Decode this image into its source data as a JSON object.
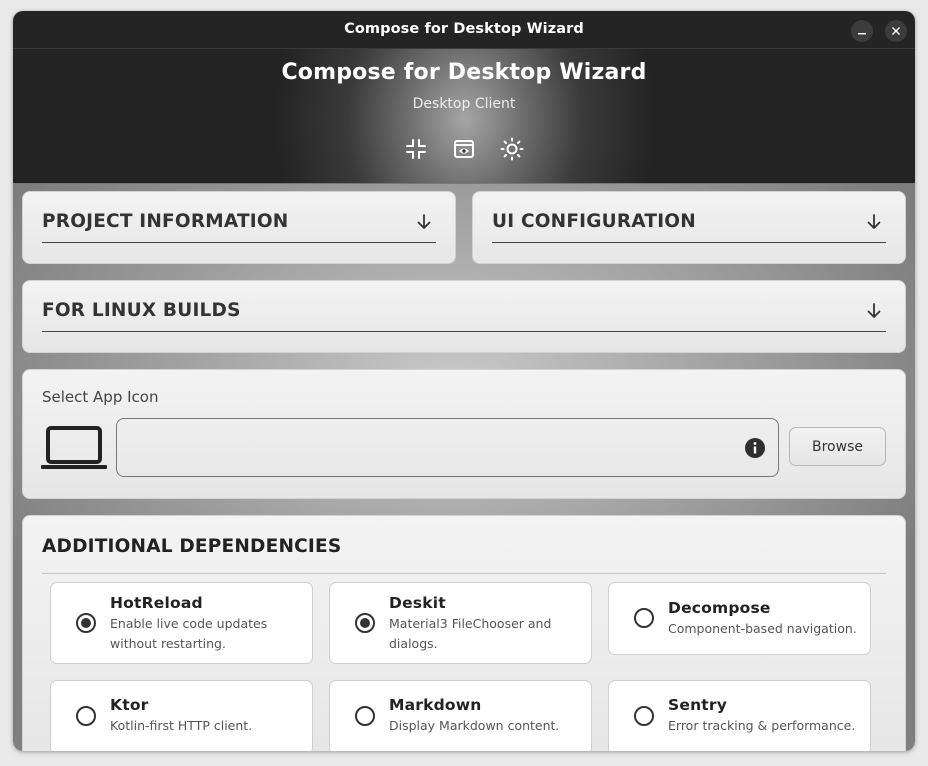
{
  "window": {
    "title": "Compose for Desktop Wizard",
    "minimize_icon": "minimize-icon",
    "close_icon": "close-icon"
  },
  "header": {
    "title": "Compose for Desktop Wizard",
    "subtitle": "Desktop Client",
    "actions": [
      "collapse-icon",
      "preview-icon",
      "theme-icon"
    ]
  },
  "sections": {
    "project_info": "PROJECT INFORMATION",
    "ui_config": "UI CONFIGURATION",
    "linux_builds": "FOR LINUX BUILDS"
  },
  "app_icon": {
    "label": "Select App Icon",
    "value": "",
    "browse_label": "Browse"
  },
  "dependencies": {
    "title": "ADDITIONAL DEPENDENCIES",
    "items": [
      {
        "name": "HotReload",
        "desc": "Enable live code updates without restarting.",
        "selected": true
      },
      {
        "name": "Deskit",
        "desc": "Material3 FileChooser and dialogs.",
        "selected": true
      },
      {
        "name": "Decompose",
        "desc": "Component-based navigation.",
        "selected": false
      },
      {
        "name": "Ktor",
        "desc": "Kotlin-first HTTP client.",
        "selected": false
      },
      {
        "name": "Markdown",
        "desc": "Display Markdown content.",
        "selected": false
      },
      {
        "name": "Sentry",
        "desc": "Error tracking & performance.",
        "selected": false
      }
    ]
  },
  "colors": {
    "titlebar": "#242424",
    "accent": "#333333"
  }
}
